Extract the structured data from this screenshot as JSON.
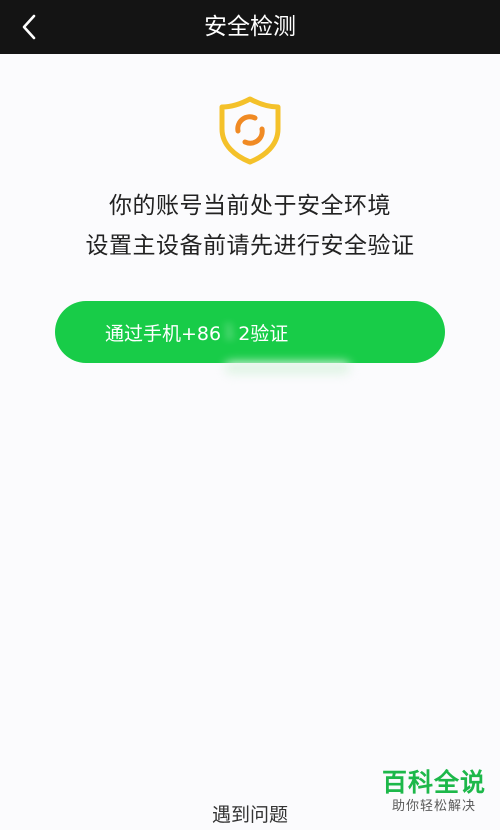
{
  "nav": {
    "title": "安全检测",
    "back_icon": "chevron-left-icon"
  },
  "main": {
    "shield_icon": "shield-icon",
    "line1": "你的账号当前处于安全环境",
    "line2": "设置主设备前请先进行安全验证",
    "verify_button": {
      "prefix": "通过手机+86",
      "masked_number": "1",
      "suffix": "2验证"
    }
  },
  "footer": {
    "problem_link": "遇到问题"
  },
  "watermark": {
    "main": "百科全说",
    "sub": "助你轻松解决"
  },
  "colors": {
    "nav_bg": "#141414",
    "accent_green": "#18cc48",
    "shield_yellow": "#f4c12a",
    "shield_orange": "#f08a24"
  }
}
